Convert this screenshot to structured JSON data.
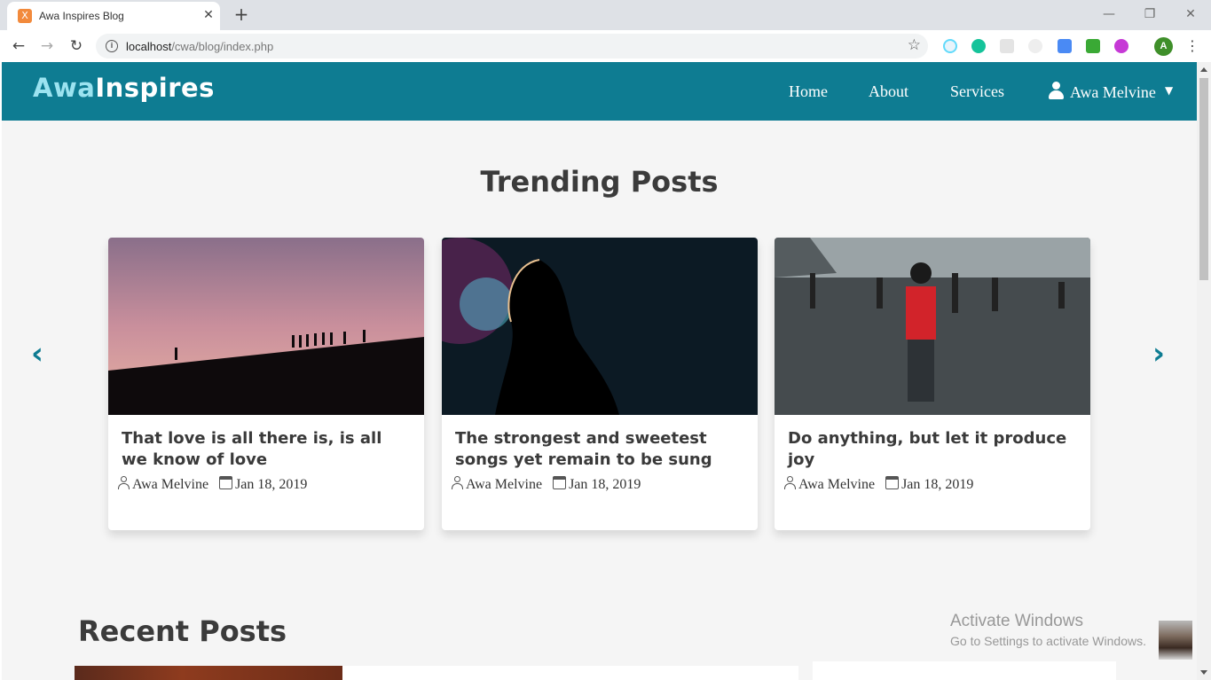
{
  "browser": {
    "tab_title": "Awa Inspires Blog",
    "tab_favicon": "X",
    "new_tab": "+",
    "close": "✕",
    "url_host": "localhost",
    "url_path": "/cwa/blog/index.php",
    "profile_initial": "A"
  },
  "nav": {
    "logo_part1": "Awa",
    "logo_part2": "Inspires",
    "home": "Home",
    "about": "About",
    "services": "Services",
    "user": "Awa Melvine",
    "accent_color": "#0e7c92"
  },
  "trending": {
    "title": "Trending Posts",
    "posts": [
      {
        "title": "That love is all there is, is all we know of love",
        "author": "Awa Melvine",
        "date": "Jan 18, 2019"
      },
      {
        "title": "The strongest and sweetest songs yet remain to be sung",
        "author": "Awa Melvine",
        "date": "Jan 18, 2019"
      },
      {
        "title": "Do anything, but let it produce joy",
        "author": "Awa Melvine",
        "date": "Jan 18, 2019"
      }
    ]
  },
  "recent": {
    "title": "Recent Posts"
  },
  "overlay": {
    "activate_line1": "Activate Windows",
    "activate_line2": "Go to Settings to activate Windows."
  }
}
